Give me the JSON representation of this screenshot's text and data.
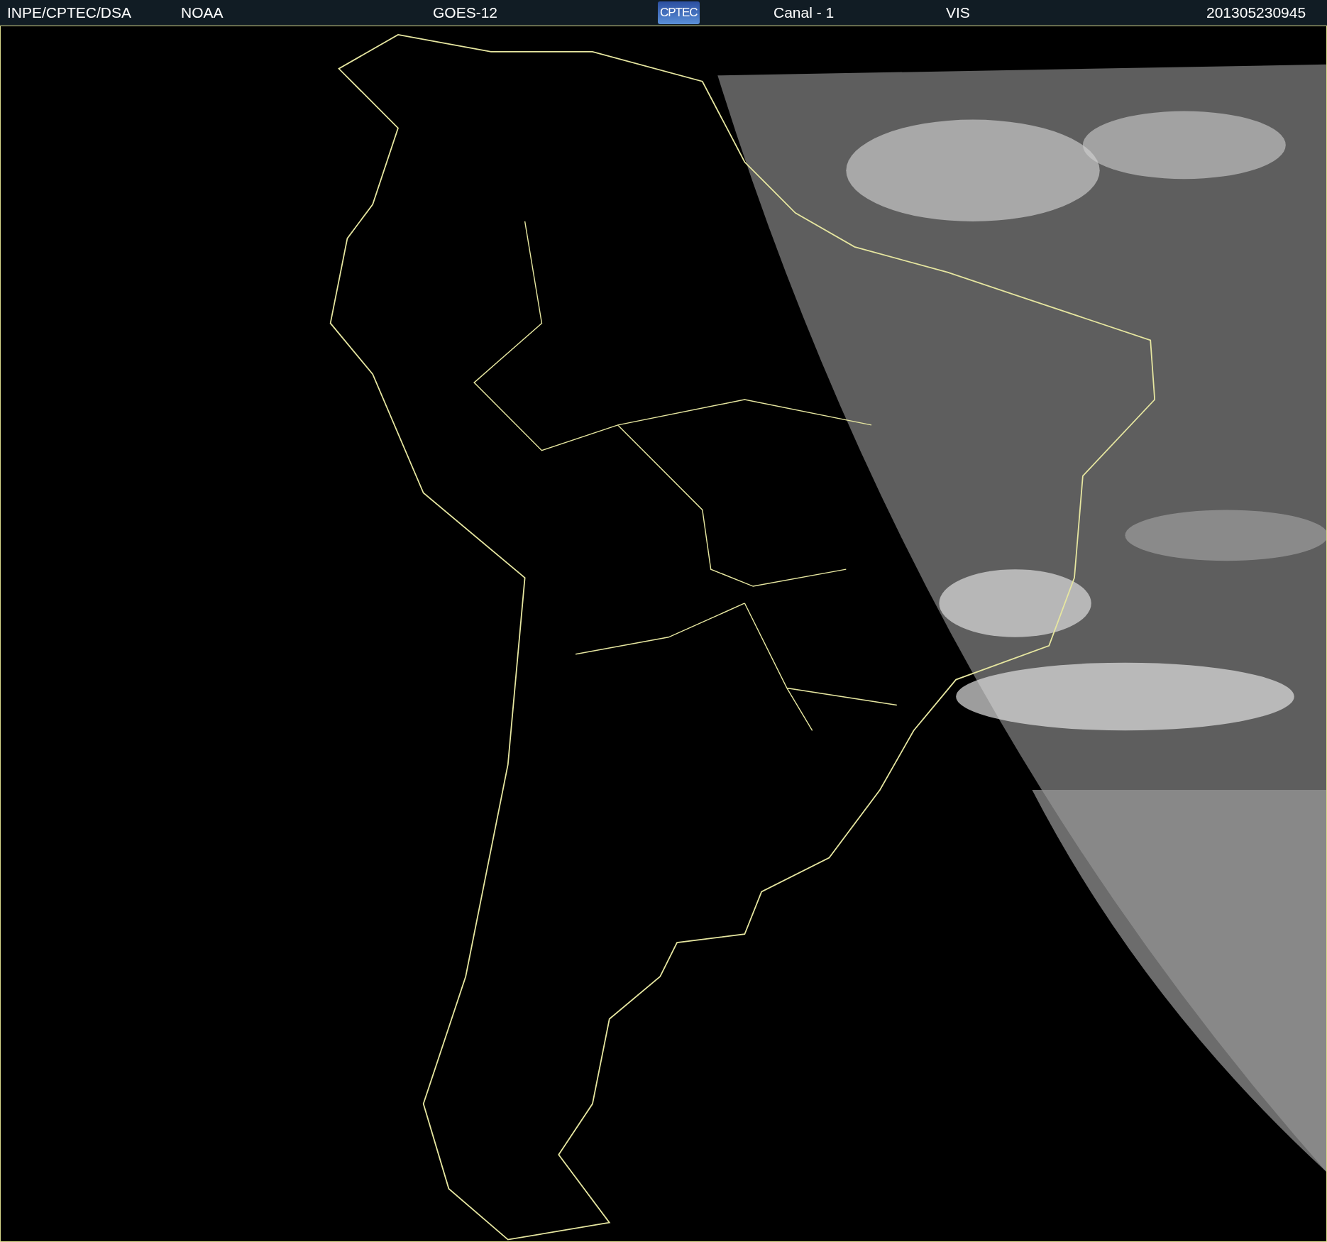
{
  "header": {
    "items": [
      {
        "kind": "text",
        "text": "INPE/CPTEC/DSA"
      },
      {
        "kind": "text",
        "text": "NOAA"
      },
      {
        "kind": "text",
        "text": "GOES-12"
      },
      {
        "kind": "logo",
        "text": "CPTEC"
      },
      {
        "kind": "text",
        "text": "Canal - 1"
      },
      {
        "kind": "text",
        "text": "VIS"
      },
      {
        "kind": "text",
        "text": "201305230945"
      }
    ]
  }
}
